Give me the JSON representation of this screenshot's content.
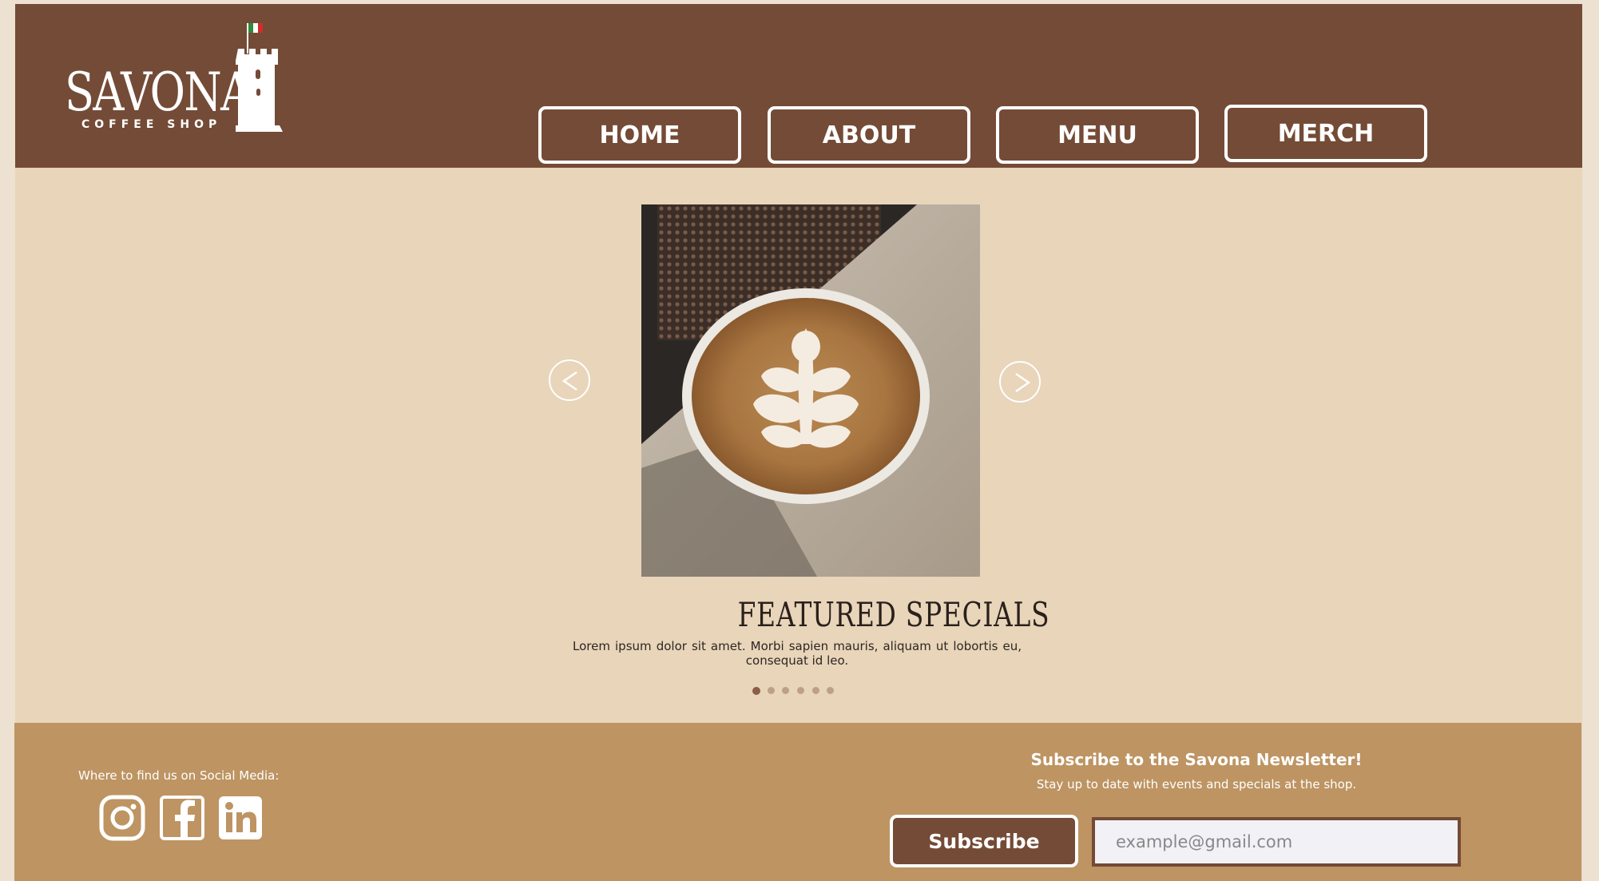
{
  "logo": {
    "name": "SAVONA",
    "tagline": "COFFEE SHOP"
  },
  "nav": [
    {
      "label": "HOME"
    },
    {
      "label": "ABOUT"
    },
    {
      "label": "MENU"
    },
    {
      "label": "MERCH"
    }
  ],
  "carousel": {
    "prev_icon": "chevron-left-icon",
    "next_icon": "chevron-right-icon",
    "image": "latte-art-coffee-cup",
    "title": "FEATURED SPECIALS",
    "text": "Lorem ipsum dolor sit amet. Morbi sapien mauris, aliquam ut lobortis eu, consequat id leo.",
    "dot_count": 6,
    "active_index": 0
  },
  "footer": {
    "social_label": "Where to find us on Social Media:",
    "social_icons": [
      "instagram-icon",
      "facebook-icon",
      "linkedin-icon"
    ],
    "newsletter": {
      "title": "Subscribe to the Savona Newsletter!",
      "subtitle": "Stay up to date with events and specials at the shop.",
      "button_label": "Subscribe",
      "email_placeholder": "example@gmail.com"
    }
  },
  "colors": {
    "header_bg": "#744b36",
    "page_bg": "#e8d5ba",
    "footer_bg": "#bd9462",
    "text_dark": "#2a201c"
  }
}
